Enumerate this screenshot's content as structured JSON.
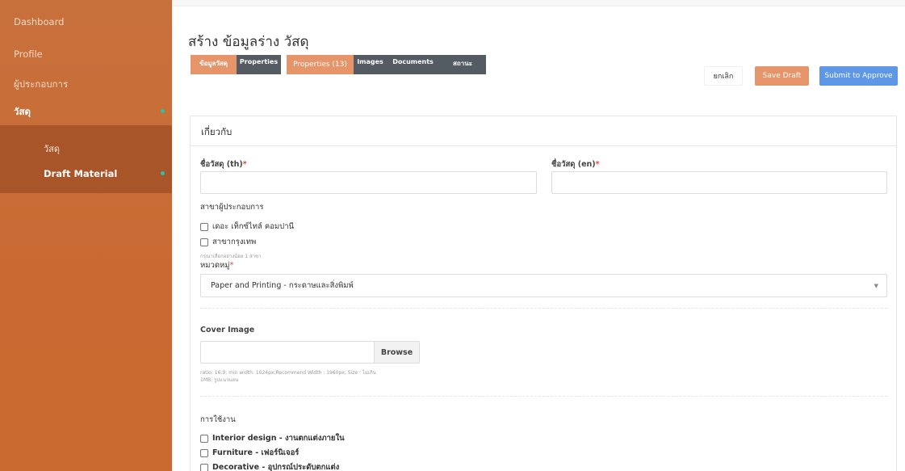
{
  "sidebar": {
    "items": [
      {
        "label": "Dashboard"
      },
      {
        "label": "Profile"
      },
      {
        "label": "ผู้ประกอบการ"
      },
      {
        "label": "วัสดุ"
      }
    ],
    "submenu": [
      {
        "label": "วัสดุ"
      },
      {
        "label": "Draft Material"
      }
    ]
  },
  "page": {
    "title": "สร้าง ข้อมูลร่าง วัสดุ"
  },
  "tabs": [
    {
      "label": "ข้อมูลวัสดุ"
    },
    {
      "label": "Properties"
    },
    {
      "label": "Properties (13)"
    },
    {
      "label": "Images"
    },
    {
      "label": "Documents"
    },
    {
      "label": "สถานะ"
    }
  ],
  "actions": {
    "cancel": "ยกเลิก",
    "save_draft": "Save Draft",
    "submit": "Submit to Approve"
  },
  "card": {
    "title": "เกี่ยวกับ"
  },
  "form": {
    "name_th_label": "ชื่อวัสดุ (th)",
    "name_en_label": "ชื่อวัสดุ (en)",
    "required_mark": "*",
    "name_th_value": "",
    "name_en_value": "",
    "branch_label": "สาขาผู้ประกอบการ",
    "branches": [
      {
        "label": "เดอะ เท็กซ์ไทล์ คอมปานี"
      },
      {
        "label": "สาขากรุงเทพ"
      }
    ],
    "branch_hint": "กรุณาเลือกอย่างน้อย 1 สาขา",
    "category_label": "หมวดหมู่",
    "category_value": "Paper and Printing - กระดาษและสิ่งพิมพ์",
    "cover_label": "Cover Image",
    "browse_label": "Browse",
    "cover_hint_line1": "ratio: 16:9; min width: 1024px;Recommend Width : 1960px; Size : ไม่เกิน",
    "cover_hint_line2": "1MB; รูปแนวนอน",
    "usage_label": "การใช้งาน",
    "usages": [
      {
        "label": "Interior design - งานตกแต่งภายใน"
      },
      {
        "label": "Furniture - เฟอร์นิเจอร์"
      },
      {
        "label": "Decorative - อุปกรณ์ประดับตกแต่ง"
      }
    ]
  },
  "colors": {
    "sidebar": "#c96a32",
    "submenu": "#a9552a",
    "accent_orange": "#e6946a",
    "tab_dark": "#555b62",
    "submit_blue": "#5d97e6",
    "active_dot": "#29c4a5",
    "required": "#e24a3b"
  },
  "icons": {
    "select_caret": "▼"
  }
}
